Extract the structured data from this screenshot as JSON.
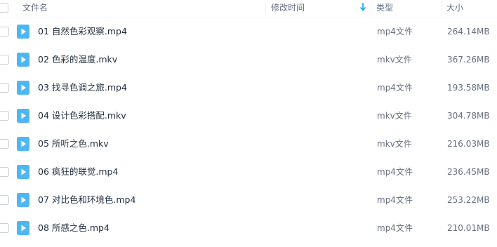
{
  "header": {
    "name_label": "文件名",
    "modified_label": "修改时间",
    "type_label": "类型",
    "size_label": "大小"
  },
  "colors": {
    "accent": "#06a7ff",
    "icon_blue": "#4fb6f5"
  },
  "files": [
    {
      "name": "01 自然色彩观察.mp4",
      "type": "mp4文件",
      "size": "264.14MB",
      "icon": "video-file-icon"
    },
    {
      "name": "02 色彩的温度.mkv",
      "type": "mkv文件",
      "size": "367.26MB",
      "icon": "video-file-icon"
    },
    {
      "name": "03 找寻色调之旅.mp4",
      "type": "mp4文件",
      "size": "193.58MB",
      "icon": "video-file-icon"
    },
    {
      "name": "04 设计色彩搭配.mkv",
      "type": "mkv文件",
      "size": "304.78MB",
      "icon": "video-file-icon"
    },
    {
      "name": "05 所听之色.mkv",
      "type": "mkv文件",
      "size": "216.03MB",
      "icon": "video-file-icon"
    },
    {
      "name": "06 疯狂的联觉.mp4",
      "type": "mp4文件",
      "size": "236.45MB",
      "icon": "video-file-icon"
    },
    {
      "name": "07 对比色和环境色.mp4",
      "type": "mp4文件",
      "size": "253.22MB",
      "icon": "video-file-icon"
    },
    {
      "name": "08 所感之色.mp4",
      "type": "mp4文件",
      "size": "210.01MB",
      "icon": "video-file-icon"
    }
  ]
}
